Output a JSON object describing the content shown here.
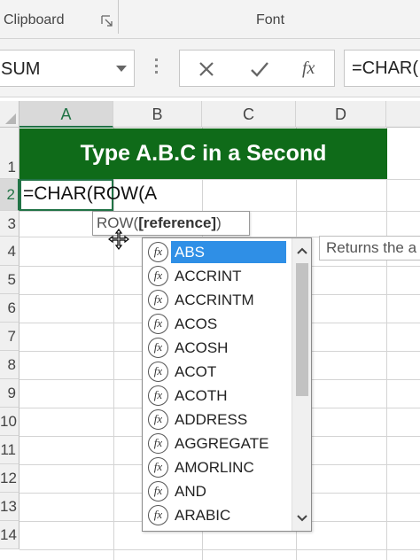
{
  "ribbon": {
    "groups": [
      {
        "label": "Clipboard"
      },
      {
        "label": "Font"
      }
    ]
  },
  "formula_bar": {
    "name_box": "SUM",
    "cancel_icon": "close-icon",
    "enter_icon": "check-icon",
    "fx_label": "fx",
    "formula_text": "=CHAR("
  },
  "columns": [
    "A",
    "B",
    "C",
    "D"
  ],
  "selected_column": "A",
  "rows": [
    "1",
    "2",
    "3",
    "4",
    "5",
    "6",
    "7",
    "8",
    "9",
    "10",
    "11",
    "12",
    "13",
    "14"
  ],
  "selected_row": "2",
  "cells": {
    "title": "Type A.B.C in a Second",
    "a2": "=CHAR(ROW(A"
  },
  "tooltip": {
    "func": "ROW(",
    "arg": "[reference]",
    "close": ")"
  },
  "autocomplete": {
    "items": [
      "ABS",
      "ACCRINT",
      "ACCRINTM",
      "ACOS",
      "ACOSH",
      "ACOT",
      "ACOTH",
      "ADDRESS",
      "AGGREGATE",
      "AMORLINC",
      "AND",
      "ARABIC"
    ],
    "selected": "ABS",
    "icon_label": "fx"
  },
  "description": "Returns the a",
  "colors": {
    "title_band": "#0f6b19",
    "selection_accent": "#217346",
    "list_highlight": "#2f8fe6"
  }
}
